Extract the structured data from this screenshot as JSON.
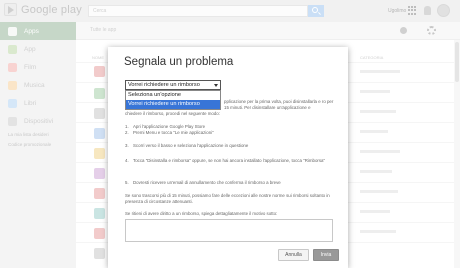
{
  "header": {
    "logo_text": "Google play",
    "search_placeholder": "Cerca",
    "user_name": "Ugolimo"
  },
  "sidebar": {
    "items": [
      {
        "label": "Apps",
        "icon": "apps-icon",
        "color": "#97b69b"
      },
      {
        "label": "App",
        "icon": "android-icon",
        "color": "#bcd8a6"
      },
      {
        "label": "Film",
        "icon": "film-icon",
        "color": "#f2b0ab"
      },
      {
        "label": "Musica",
        "icon": "music-icon",
        "color": "#f6cf9b"
      },
      {
        "label": "Libri",
        "icon": "book-icon",
        "color": "#b3d4f2"
      },
      {
        "label": "Dispositivi",
        "icon": "device-icon",
        "color": "#cccccc"
      }
    ],
    "links": [
      "La mia lista desideri",
      "Codice promozionale"
    ]
  },
  "main": {
    "category_label": "Tutte le app",
    "columns": [
      "NOME",
      "CATEGORIA"
    ]
  },
  "dialog": {
    "title": "Segnala un problema",
    "select_value": "Vorrei richiedere un rimborso",
    "options": [
      "Seleziona un'opzione",
      "Vorrei richiedere un rimborso"
    ],
    "intro_right": "pplicazione per la prima volta, puoi disinstallarla e ro per 15 minuti. Per disinstallare un'applicazione e",
    "intro_line": "chiedere il rimborso, procedi nel seguente modo:",
    "steps": [
      {
        "num": "1.",
        "text": "Apri l'applicazione Google Play Store"
      },
      {
        "num": "2.",
        "text": "Premi Menu e tocca \"Le mie applicazioni\""
      },
      {
        "num": "3.",
        "text": "Scorri verso il basso e seleziona l'applicazione in questione"
      },
      {
        "num": "4.",
        "text": "Tocca \"Disinstalla e rimborsa\" oppure, se non hai ancora installato l'applicazione, tocca \"Rimborsa\""
      },
      {
        "num": "5.",
        "text": "Dovresti ricevere un'email di annullamento che conferma il rimborso a breve"
      }
    ],
    "note": "Se sono trascorsi più di 15 minuti, possiamo fare delle eccezioni alle nostre norme sui rimborsi soltanto in presenza di circostanze attenuanti.",
    "textarea_label": "Se ritieni di avere diritto a un rimborso, spiega dettagliatamente il motivo sotto:",
    "cancel_label": "Annulla",
    "submit_label": "Invia"
  }
}
